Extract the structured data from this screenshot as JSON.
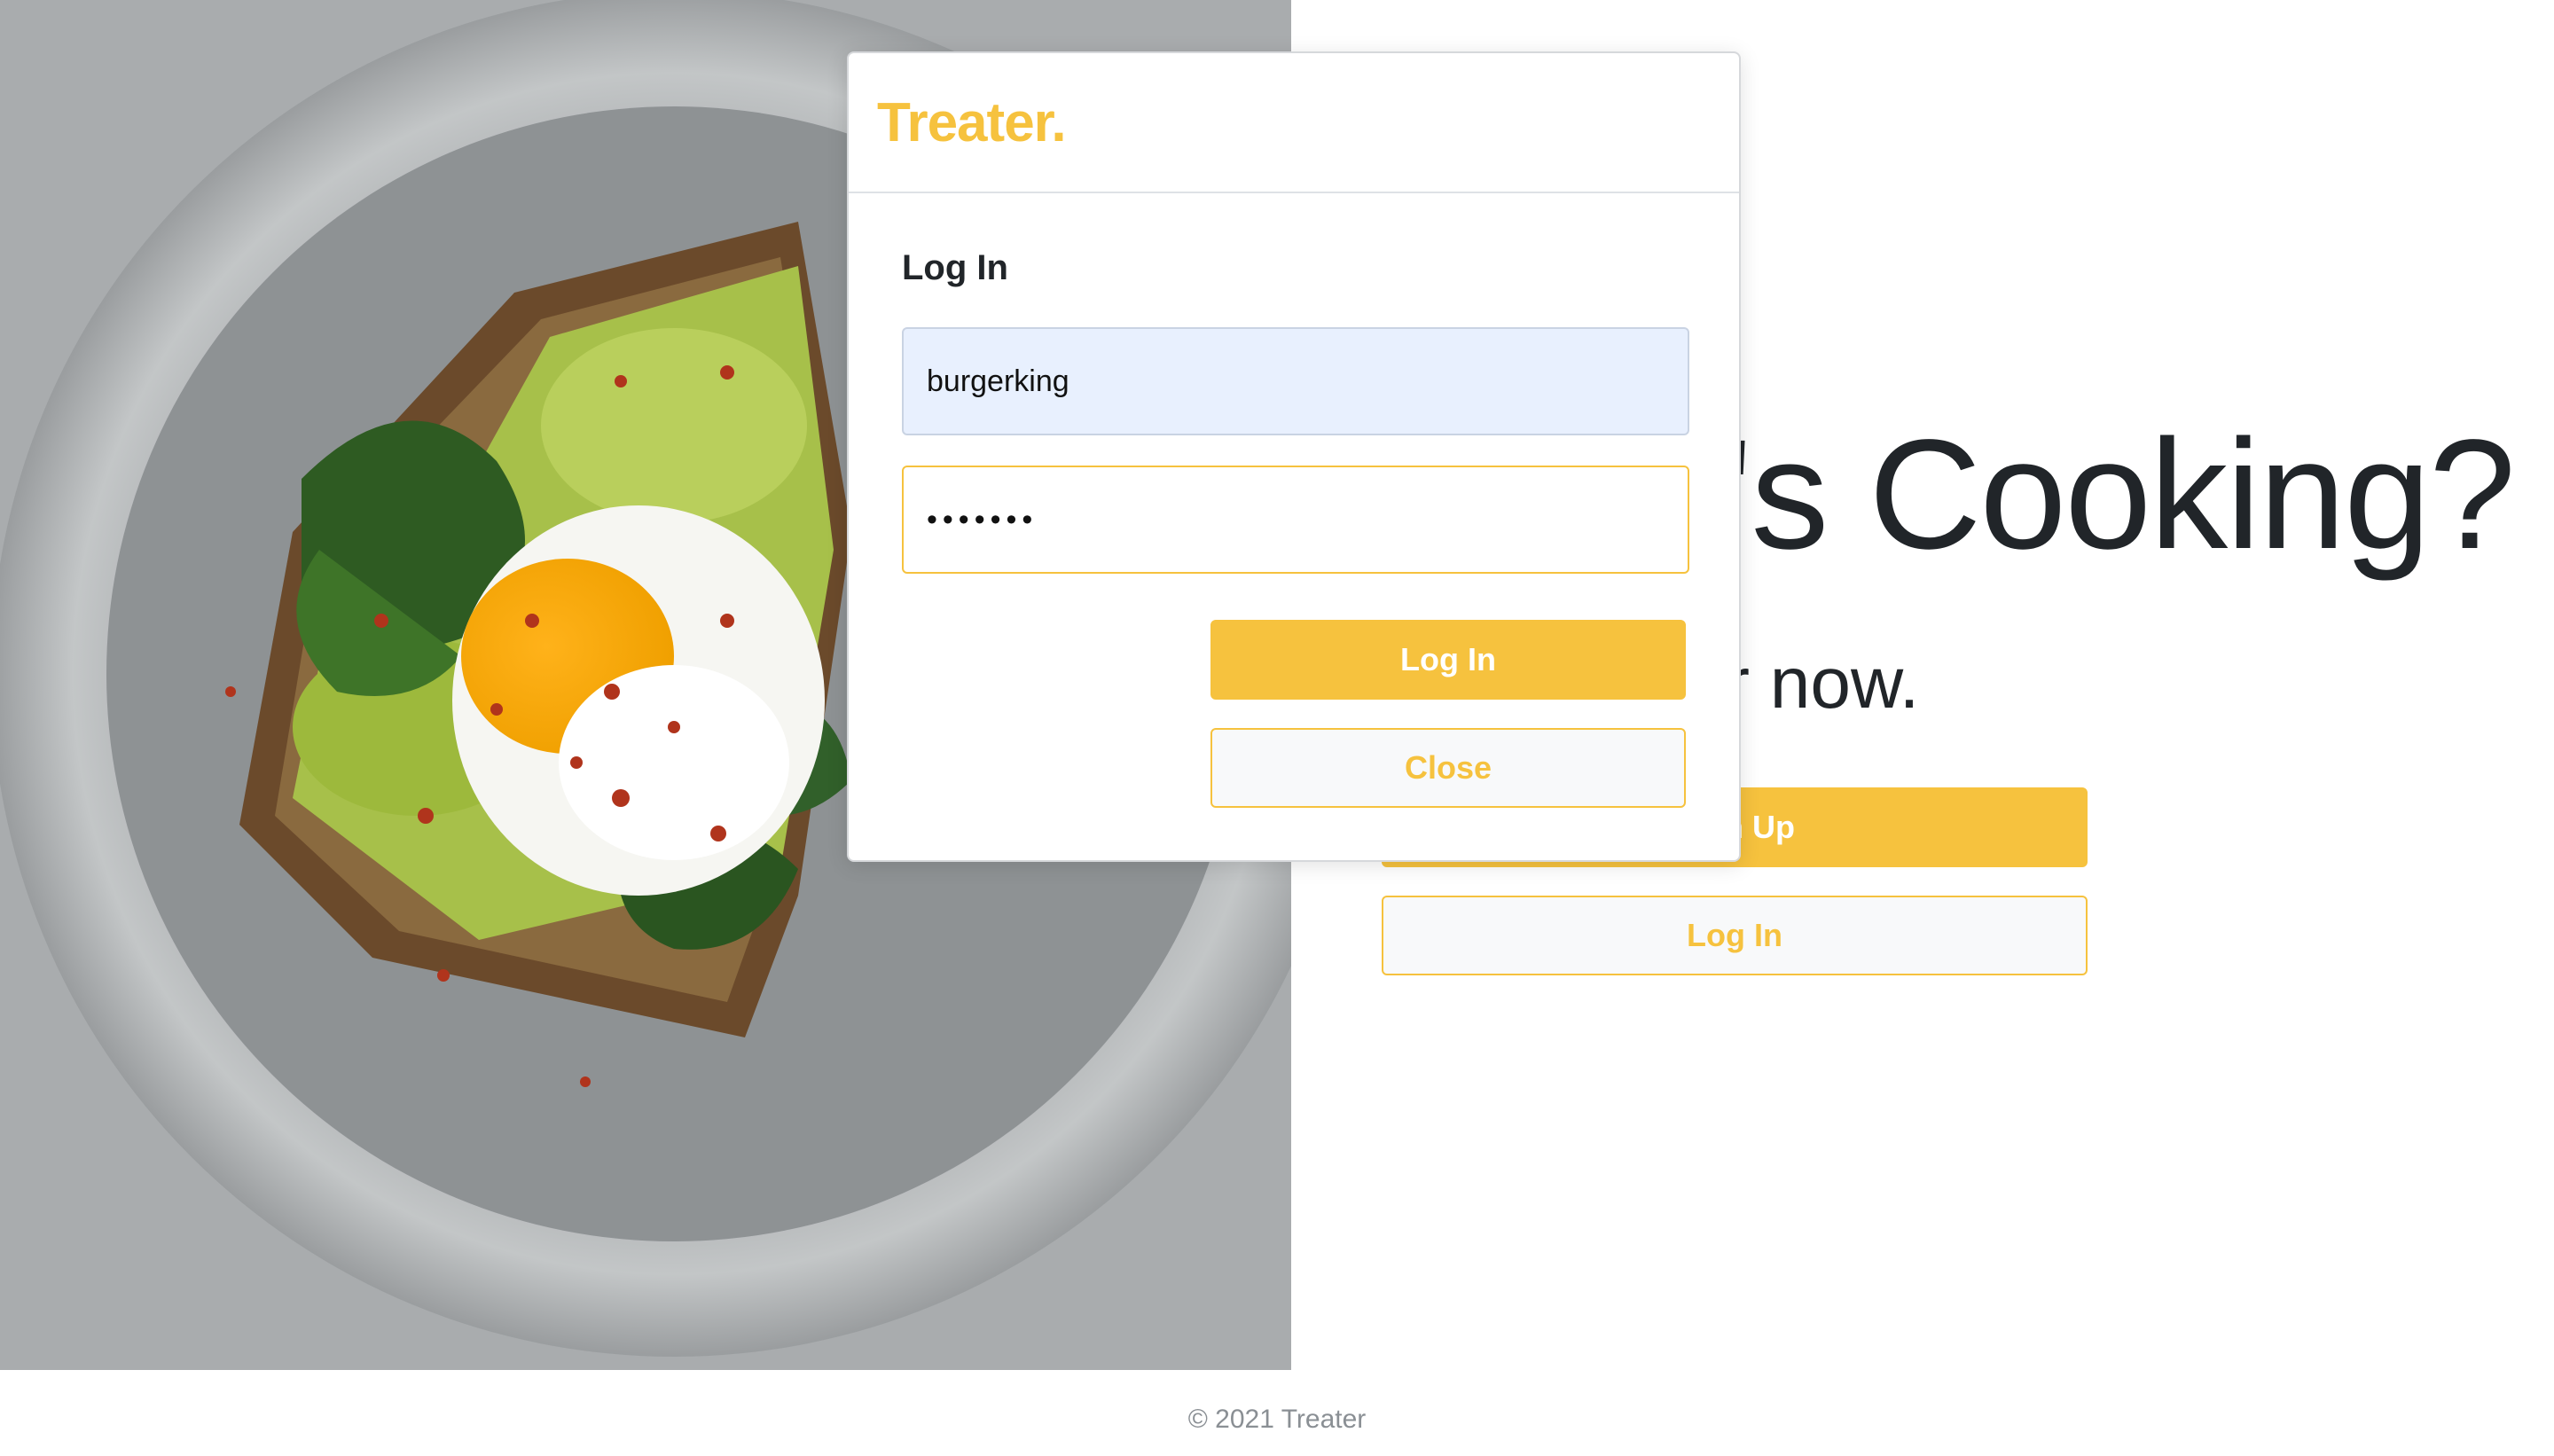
{
  "hero": {
    "heading": "What's Cooking?",
    "subheading": "Join Treater now.",
    "signup_button": "Sign Up",
    "login_button": "Log In"
  },
  "modal": {
    "brand": "Treater.",
    "title": "Log In",
    "username": {
      "value": "burgerking"
    },
    "password": {
      "value": "•••••••"
    },
    "login_button": "Log In",
    "close_button": "Close"
  },
  "footer": {
    "text": "© 2021 Treater"
  },
  "colors": {
    "accent": "#f6c23e",
    "text": "#212529",
    "autofill": "#e8f0fe",
    "button_light": "#f8f9fa"
  },
  "icons": {
    "hero_image": "avocado-toast-poached-egg-photo"
  }
}
